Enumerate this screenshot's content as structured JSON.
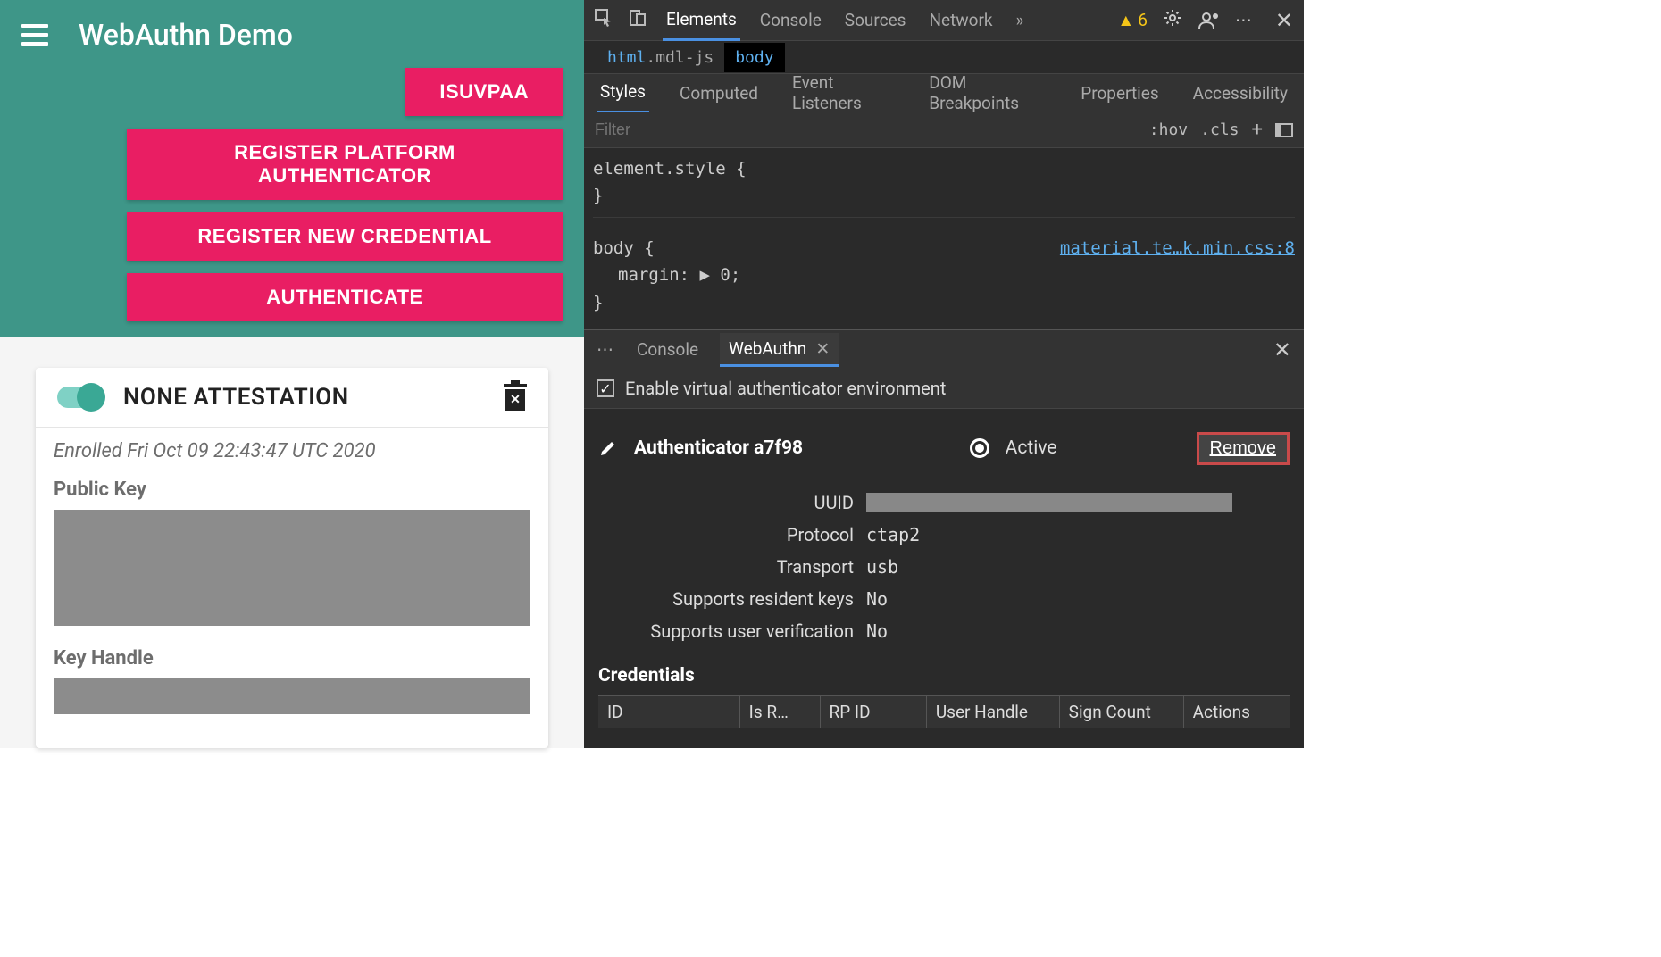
{
  "app": {
    "title": "WebAuthn Demo",
    "buttons": {
      "isuvpaa": "ISUVPAA",
      "register_platform": "REGISTER PLATFORM AUTHENTICATOR",
      "register_new": "REGISTER NEW CREDENTIAL",
      "authenticate": "AUTHENTICATE"
    },
    "card": {
      "title": "NONE ATTESTATION",
      "enrolled": "Enrolled Fri Oct 09 22:43:47 UTC 2020",
      "public_key_label": "Public Key",
      "key_handle_label": "Key Handle"
    }
  },
  "devtools": {
    "tabs": {
      "elements": "Elements",
      "console": "Console",
      "sources": "Sources",
      "network": "Network"
    },
    "more": "»",
    "warning_count": "6",
    "breadcrumb": {
      "html": "html",
      "mdl": ".mdl-js",
      "body": "body"
    },
    "subtabs": {
      "styles": "Styles",
      "computed": "Computed",
      "listeners": "Event Listeners",
      "dom": "DOM Breakpoints",
      "properties": "Properties",
      "accessibility": "Accessibility"
    },
    "filter": {
      "placeholder": "Filter",
      "hov": ":hov",
      "cls": ".cls"
    },
    "css": {
      "element_style": "element.style {",
      "close1": "}",
      "body_sel": "body {",
      "margin_prop": "margin",
      "margin_val": "▶ 0",
      "close2": "}",
      "link": "material.te…k.min.css:8"
    },
    "drawer": {
      "console": "Console",
      "webauthn": "WebAuthn",
      "enable_label": "Enable virtual authenticator environment"
    },
    "auth": {
      "name": "Authenticator a7f98",
      "active_label": "Active",
      "remove_label": "Remove",
      "fields": {
        "uuid_label": "UUID",
        "protocol_label": "Protocol",
        "protocol_val": "ctap2",
        "transport_label": "Transport",
        "transport_val": "usb",
        "resident_label": "Supports resident keys",
        "resident_val": "No",
        "verify_label": "Supports user verification",
        "verify_val": "No"
      },
      "credentials_title": "Credentials",
      "table": {
        "id": "ID",
        "isr": "Is R…",
        "rpid": "RP ID",
        "userhandle": "User Handle",
        "signcount": "Sign Count",
        "actions": "Actions"
      }
    }
  }
}
